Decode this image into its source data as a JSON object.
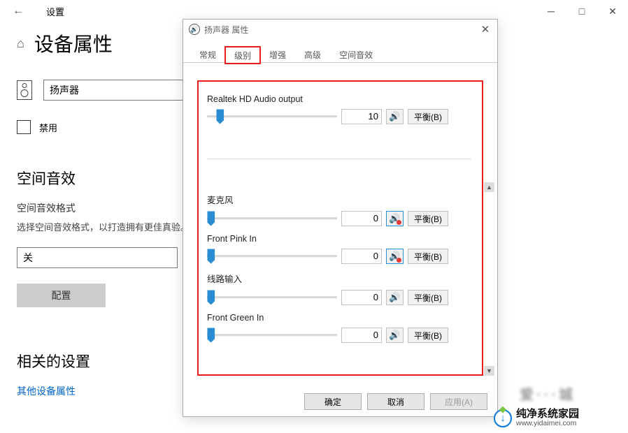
{
  "settings": {
    "title": "设置",
    "header": "设备属性",
    "device_name": "扬声器",
    "disable_label": "禁用",
    "spatial_section": "空间音效",
    "spatial_format_label": "空间音效格式",
    "spatial_desc": "选择空间音效格式，以打造拥有更佳真验。",
    "spatial_value": "关",
    "configure_btn": "配置",
    "related_section": "相关的设置",
    "other_props_link": "其他设备属性"
  },
  "dialog": {
    "title": "扬声器 属性",
    "tabs": [
      "常规",
      "级别",
      "增强",
      "高级",
      "空间音效"
    ],
    "active_tab": 1,
    "channels": [
      {
        "name": "Realtek HD Audio output",
        "value": "10",
        "pos": 10,
        "muted": false,
        "balance": "平衡(B)"
      },
      {
        "name": "麦克风",
        "value": "0",
        "pos": 3,
        "muted": true,
        "balance": "平衡(B)"
      },
      {
        "name": "Front Pink In",
        "value": "0",
        "pos": 3,
        "muted": true,
        "balance": "平衡(B)"
      },
      {
        "name": "线路输入",
        "value": "0",
        "pos": 3,
        "muted": false,
        "balance": "平衡(B)"
      },
      {
        "name": "Front Green In",
        "value": "0",
        "pos": 3,
        "muted": false,
        "balance": "平衡(B)"
      }
    ],
    "footer": {
      "ok": "确定",
      "cancel": "取消",
      "apply": "应用(A)"
    }
  },
  "watermark": {
    "name": "纯净系统家园",
    "url": "www.yidaimei.com"
  }
}
